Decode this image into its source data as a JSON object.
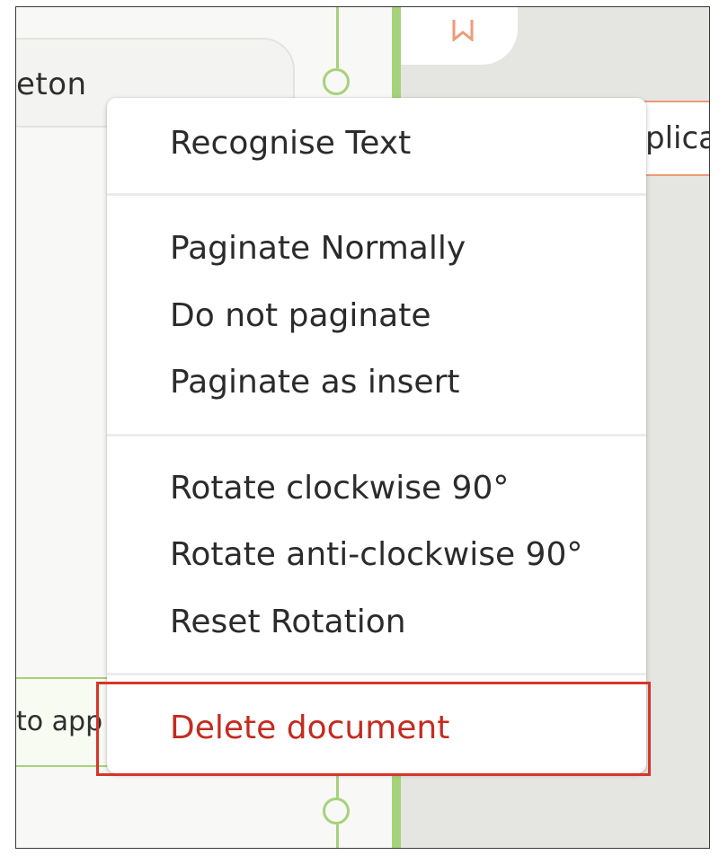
{
  "background": {
    "left_card_text": "eton",
    "right_chip_text": "plica",
    "bottom_chip_text": "to app"
  },
  "context_menu": {
    "groups": [
      {
        "items": [
          {
            "label": "Recognise Text"
          }
        ]
      },
      {
        "items": [
          {
            "label": "Paginate Normally"
          },
          {
            "label": "Do not paginate"
          },
          {
            "label": "Paginate as insert"
          }
        ]
      },
      {
        "items": [
          {
            "label": "Rotate clockwise 90°"
          },
          {
            "label": "Rotate anti-clockwise 90°"
          },
          {
            "label": "Reset Rotation"
          }
        ]
      },
      {
        "items": [
          {
            "label": "Delete document"
          }
        ]
      }
    ]
  },
  "colors": {
    "accent_green": "#a6d27a",
    "accent_orange": "#ef9a77",
    "danger_red": "#c42b20",
    "highlight_red": "#d6352a"
  },
  "icons": {
    "top_card_icon": "bookmark-icon"
  }
}
